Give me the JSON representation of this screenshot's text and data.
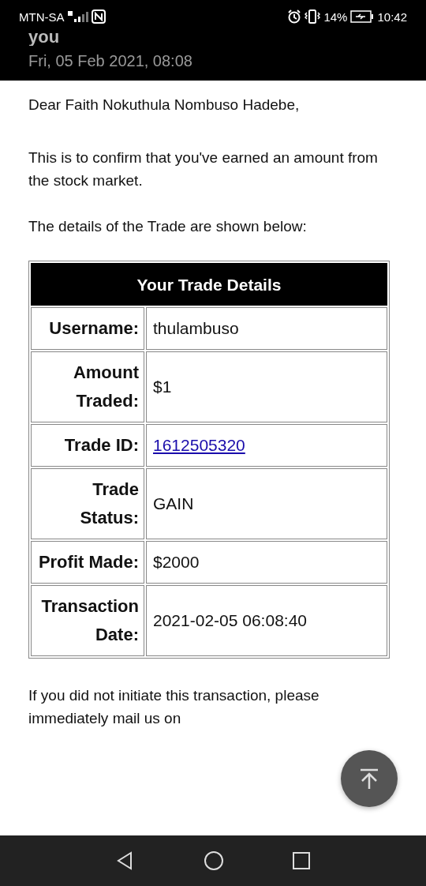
{
  "status_bar": {
    "carrier": "MTN-SA",
    "battery": "14%",
    "time": "10:42"
  },
  "header": {
    "title": "you",
    "date": "Fri, 05 Feb 2021, 08:08"
  },
  "email": {
    "greeting": "Dear Faith Nokuthula Nombuso Hadebe,",
    "paragraphs": [
      "This is to confirm that you've earned an amount from the stock market.",
      "The details of the Trade are shown below:"
    ],
    "table": {
      "title": "Your Trade Details",
      "rows": [
        {
          "label": "Username:",
          "value": "thulambuso",
          "kind": "text"
        },
        {
          "label": "Amount Traded:",
          "value": "$1",
          "kind": "text"
        },
        {
          "label": "Trade ID:",
          "value": "1612505320",
          "kind": "link"
        },
        {
          "label": "Trade Status:",
          "value": "GAIN",
          "kind": "text"
        },
        {
          "label": "Profit Made:",
          "value": "$2000",
          "kind": "text"
        },
        {
          "label": "Transaction Date:",
          "value": "2021-02-05 06:08:40",
          "kind": "text"
        }
      ]
    },
    "footer": "If you did not initiate this transaction, please immediately mail us on"
  }
}
